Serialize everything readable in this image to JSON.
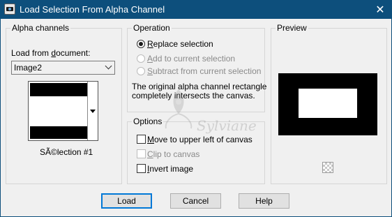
{
  "window": {
    "title": "Load Selection From Alpha Channel",
    "close_glyph": "✕"
  },
  "alpha_channels": {
    "legend": "Alpha channels",
    "load_from_label_prefix": "Load from ",
    "load_from_label_underlined": "d",
    "load_from_label_suffix": "ocument:",
    "document_selected": "Image2",
    "channel_name": "SÃ©lection #1"
  },
  "operation": {
    "legend": "Operation",
    "options": [
      {
        "accel": "R",
        "rest": "eplace selection",
        "selected": true,
        "enabled": true
      },
      {
        "accel": "A",
        "rest": "dd to current selection",
        "selected": false,
        "enabled": false
      },
      {
        "accel": "S",
        "rest": "ubtract from current selection",
        "selected": false,
        "enabled": false
      }
    ],
    "message_line1": "The original alpha channel rectangle",
    "message_line2": "completely intersects the canvas."
  },
  "options": {
    "legend": "Options",
    "items": [
      {
        "accel": "M",
        "rest": "ove to upper left of canvas",
        "checked": false,
        "enabled": true
      },
      {
        "accel": "C",
        "rest": "lip to canvas",
        "checked": false,
        "enabled": false
      },
      {
        "accel": "I",
        "rest": "nvert image",
        "checked": false,
        "enabled": true
      }
    ]
  },
  "preview": {
    "legend": "Preview"
  },
  "watermark": "Sylviane",
  "buttons": {
    "load": "Load",
    "cancel": "Cancel",
    "help": "Help"
  }
}
